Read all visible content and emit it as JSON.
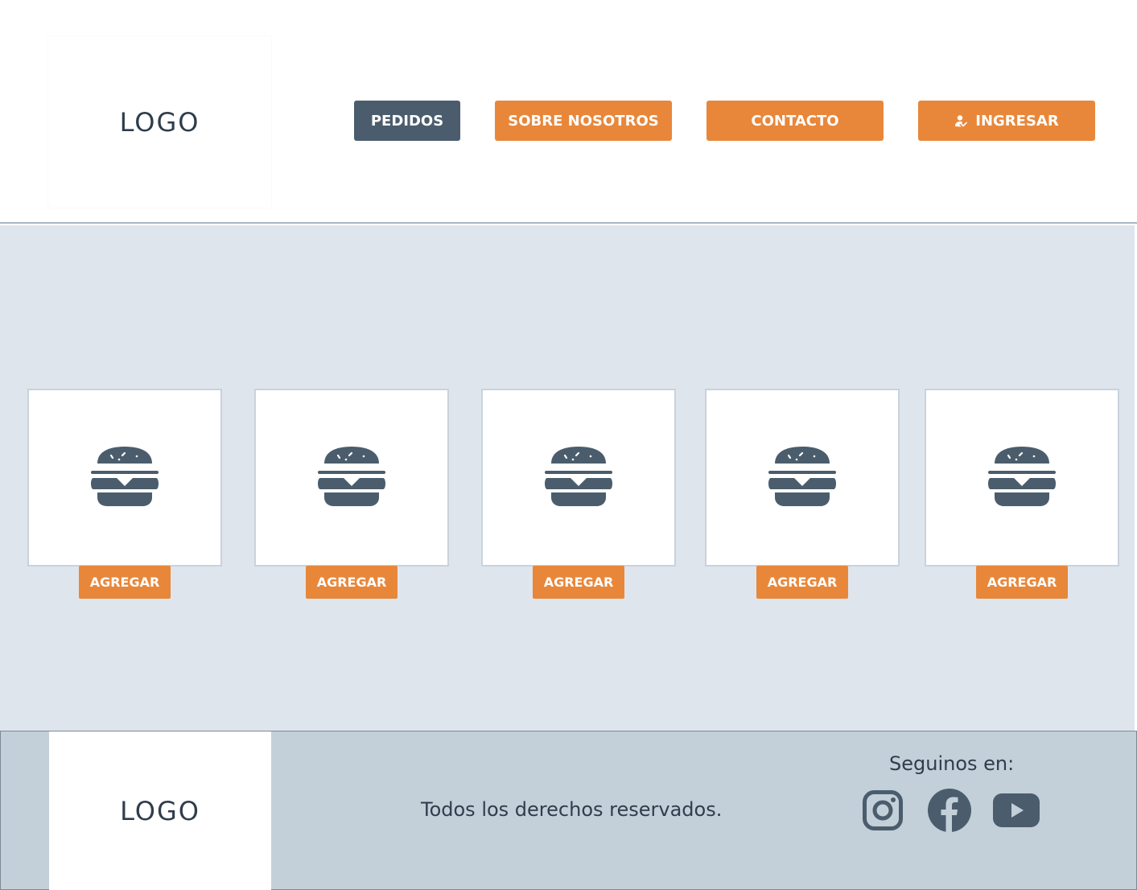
{
  "header": {
    "logo": "LOGO",
    "nav": {
      "pedidos": "PEDIDOS",
      "sobre_nosotros": "SOBRE NOSOTROS",
      "contacto": "CONTACTO",
      "ingresar": "INGRESAR"
    }
  },
  "products": [
    {
      "icon": "burger-icon",
      "button": "AGREGAR"
    },
    {
      "icon": "burger-icon",
      "button": "AGREGAR"
    },
    {
      "icon": "burger-icon",
      "button": "AGREGAR"
    },
    {
      "icon": "burger-icon",
      "button": "AGREGAR"
    },
    {
      "icon": "burger-icon",
      "button": "AGREGAR"
    }
  ],
  "footer": {
    "logo": "LOGO",
    "rights": "Todos los derechos reservados.",
    "follow": "Seguinos en:",
    "social": [
      "instagram-icon",
      "facebook-icon",
      "youtube-icon"
    ]
  },
  "colors": {
    "accent": "#e8873a",
    "dark": "#4b5d6c",
    "main_bg": "#dfe5ed",
    "footer_bg": "#c3cfd9"
  }
}
